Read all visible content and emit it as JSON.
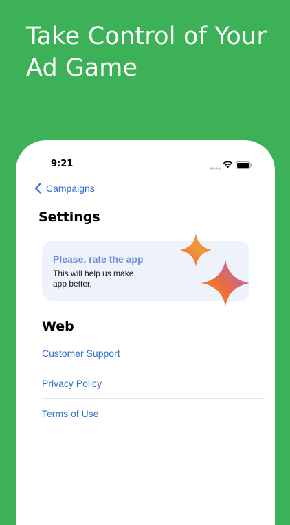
{
  "hero": {
    "line1": "Take Control of Your",
    "line2": "Ad Game"
  },
  "status_bar": {
    "time": "9:21"
  },
  "nav": {
    "back_label": "Campaigns"
  },
  "page": {
    "title": "Settings"
  },
  "rate_card": {
    "title": "Please, rate the app",
    "description": "This will help us make app better."
  },
  "web_section": {
    "title": "Web",
    "links": [
      {
        "label": "Customer Support"
      },
      {
        "label": "Privacy Policy"
      },
      {
        "label": "Terms of Use"
      }
    ]
  },
  "colors": {
    "background": "#3cb158",
    "link": "#2f72c8",
    "card_bg": "#eef2fb",
    "card_title": "#6f8fd9"
  }
}
